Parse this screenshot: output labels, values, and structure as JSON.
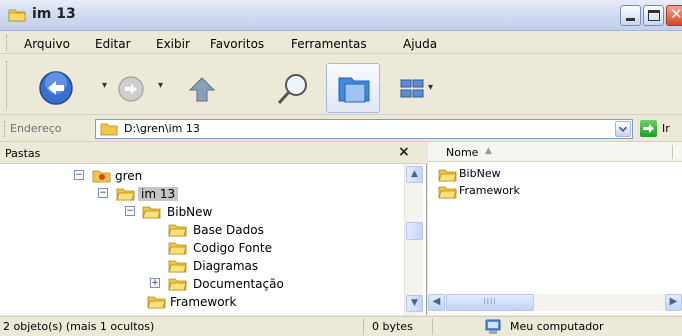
{
  "window": {
    "title": "im 13"
  },
  "menu": [
    "Arquivo",
    "Editar",
    "Exibir",
    "Favoritos",
    "Ferramentas",
    "Ajuda"
  ],
  "address": {
    "label": "Endereço",
    "value": "D:\\gren\\im 13",
    "go_label": "Ir"
  },
  "folders_pane": {
    "title": "Pastas",
    "close_glyph": "×"
  },
  "tree": [
    {
      "label": "gren",
      "toggle": "−",
      "icon": "user-folder"
    },
    {
      "label": "im 13",
      "toggle": "−",
      "icon": "open-folder",
      "selected": true
    },
    {
      "label": "BibNew",
      "toggle": "−",
      "icon": "folder"
    },
    {
      "label": "Base Dados",
      "icon": "folder"
    },
    {
      "label": "Codigo Fonte",
      "icon": "folder"
    },
    {
      "label": "Diagramas",
      "icon": "folder"
    },
    {
      "label": "Documentação",
      "toggle": "+",
      "icon": "folder"
    },
    {
      "label": "Framework",
      "icon": "folder"
    }
  ],
  "files_pane": {
    "column_name": "Nome",
    "sort_glyph": "▲",
    "items": [
      "BibNew",
      "Framework"
    ],
    "hscroll_thumb_glyph": "IIII"
  },
  "status": {
    "objects": "2 objeto(s) (mais 1 ocultos)",
    "size": "0 bytes",
    "location": "Meu computador"
  },
  "colors": {
    "title_bg": "#d2dcf2",
    "folder_yellow": "#f2c744",
    "close_red": "#d6462a",
    "go_green": "#239c23"
  }
}
